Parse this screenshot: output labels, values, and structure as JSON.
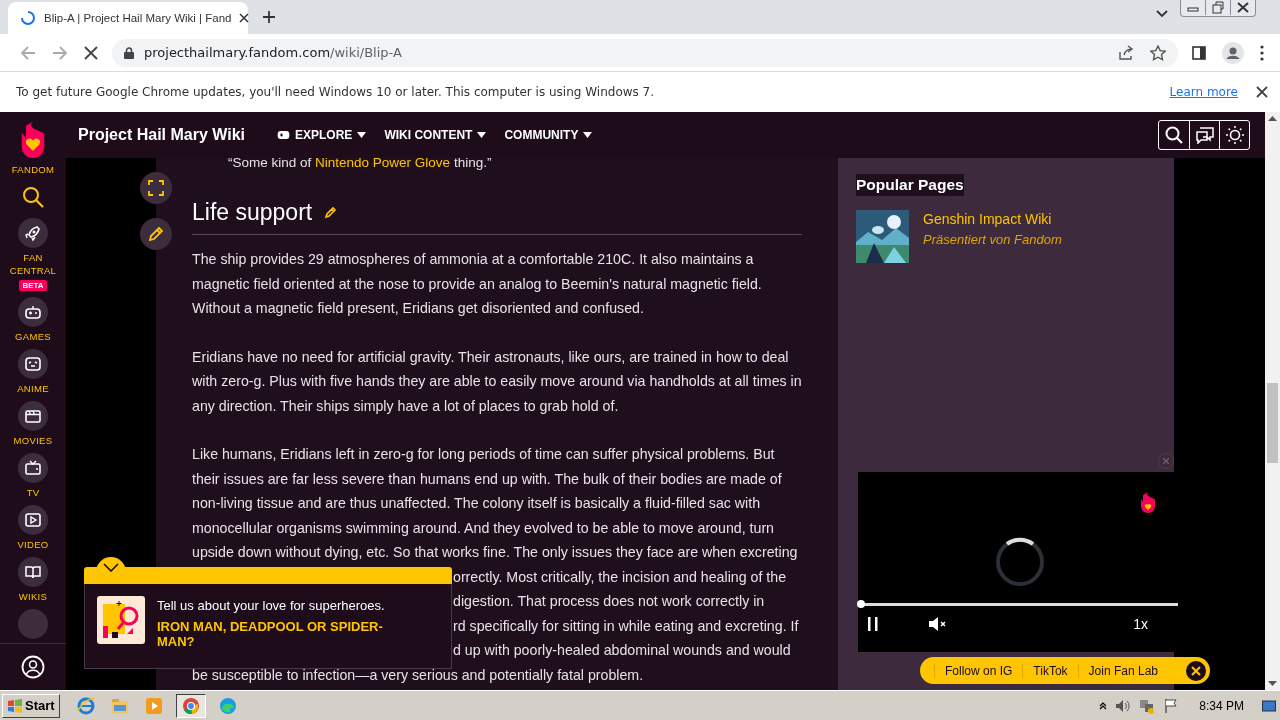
{
  "browser": {
    "tab": {
      "title": "Blip-A | Project Hail Mary Wiki | Fand",
      "loading": true
    },
    "address": {
      "host": "projecthailmary.fandom.com",
      "path": "/wiki/Blip-A"
    },
    "infobar": {
      "message": "To get future Google Chrome updates, you'll need Windows 10 or later. This computer is using Windows 7.",
      "link": "Learn more"
    }
  },
  "sidebar": {
    "logo": "FANDOM",
    "items": [
      {
        "kind": "rocket",
        "label": "FAN CENTRAL",
        "badge": "BETA"
      },
      {
        "kind": "gamepad",
        "label": "GAMES"
      },
      {
        "kind": "anime",
        "label": "ANIME"
      },
      {
        "kind": "clapper",
        "label": "MOVIES"
      },
      {
        "kind": "tv",
        "label": "TV"
      },
      {
        "kind": "video",
        "label": "VIDEO"
      },
      {
        "kind": "book",
        "label": "WIKIS"
      },
      {
        "kind": "more"
      }
    ]
  },
  "header": {
    "title": "Project Hail Mary Wiki",
    "nav": [
      {
        "label": "EXPLORE",
        "kind": "gamepad"
      },
      {
        "label": "WIKI CONTENT",
        "kind": "plain"
      },
      {
        "label": "COMMUNITY",
        "kind": "plain"
      }
    ]
  },
  "article": {
    "quote": {
      "before": "“Some kind of ",
      "link": "Nintendo Power Glove",
      "after": " thing.”"
    },
    "heading": "Life support",
    "paragraphs": [
      "The ship provides 29 atmospheres of ammonia at a comfortable 210C. It also maintains a magnetic field oriented at the nose to provide an analog to Beemin's natural magnetic field. Without a magnetic field present, Eridians get disoriented and confused.",
      "Eridians have no need for artificial gravity. Their astronauts, like ours, are trained in how to deal with zero-g. Plus with five hands they are able to easily move around via handholds at all times in any direction. Their ships simply have a lot of places to grab hold of."
    ],
    "last_paragraph_lines": [
      {
        "kind": "full",
        "text": "Like humans, Eridians left in zero-g for long periods of time can suffer physical problems. But"
      },
      {
        "kind": "full",
        "text": "their issues are far less severe than humans end up with. The bulk of their bodies are made of"
      },
      {
        "kind": "full",
        "text": "non-living tissue and are thus unaffected. The colony itself is basically a fluid-filled sac with"
      },
      {
        "kind": "full",
        "text": "monocellular organisms swimming around. And they evolved to be able to move around, turn"
      },
      {
        "kind": "full",
        "text": "upside down without dying, etc. So that works fine. The only issues they face are when excreting"
      },
      {
        "kind": "tail",
        "text": "orrectly. Most critically, the incision and healing of the"
      },
      {
        "kind": "tail",
        "text": "digestion. That process does not work correctly in"
      },
      {
        "kind": "tail",
        "text": "rd specifically for sitting in while eating and excreting. If"
      },
      {
        "kind": "tail",
        "text": "d up with poorly-healed abdominal wounds and would"
      },
      {
        "kind": "full",
        "text": "be susceptible to infection—a very serious and potentially fatal problem."
      }
    ]
  },
  "rail": {
    "heading": "Popular Pages",
    "items": [
      {
        "title": "Genshin Impact Wiki",
        "subtitle": "Präsentiert von Fandom"
      }
    ]
  },
  "video": {
    "level": 0,
    "speed": "1x",
    "muted": true
  },
  "social_bar": {
    "links": [
      "Follow on IG",
      "TikTok",
      "Join Fan Lab"
    ]
  },
  "popup": {
    "prompt": "Tell us about your love for superheroes.",
    "question": "IRON MAN, DEADPOOL OR SPIDER-MAN?"
  },
  "taskbar": {
    "start": "Start",
    "apps": [
      {
        "kind": "ie",
        "selected": false
      },
      {
        "kind": "folder",
        "selected": false
      },
      {
        "kind": "media",
        "selected": false
      },
      {
        "kind": "chrome",
        "selected": true
      },
      {
        "kind": "edge",
        "selected": false
      }
    ],
    "clock": "8:34 PM"
  }
}
